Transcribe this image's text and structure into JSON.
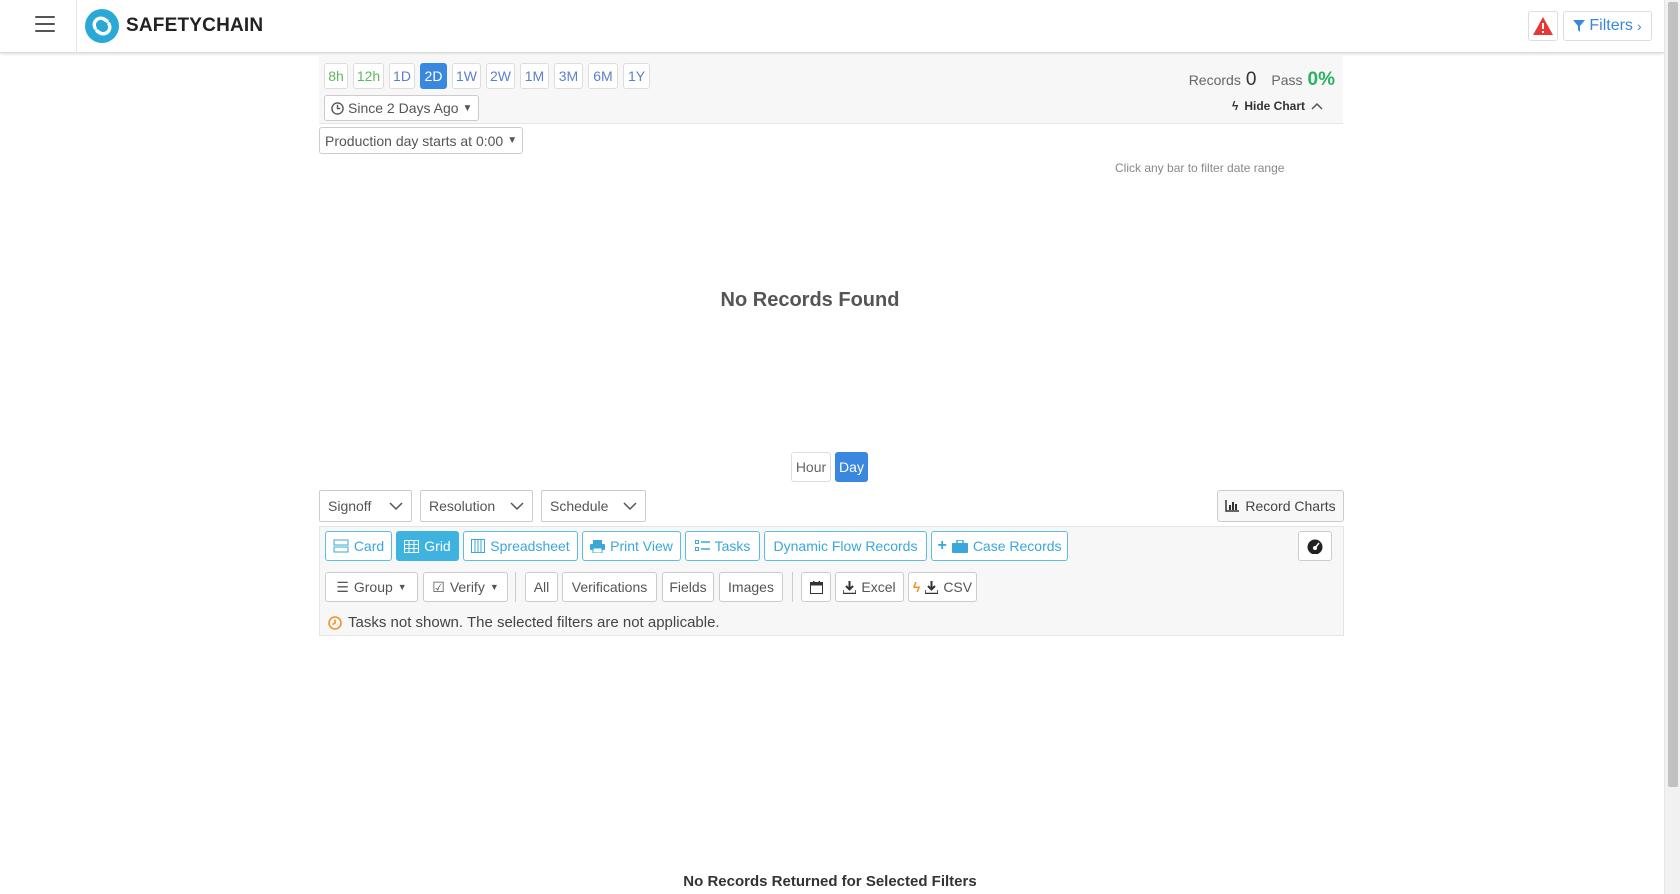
{
  "header": {
    "brand": "SAFETYCHAIN",
    "filters_label": "Filters",
    "icons": [
      "menu-icon",
      "safetychain-logo",
      "warning-icon",
      "filter-icon",
      "chevron-right-icon"
    ]
  },
  "range": {
    "buttons": [
      {
        "label": "8h",
        "state": "green"
      },
      {
        "label": "12h",
        "state": "green"
      },
      {
        "label": "1D",
        "state": "normal"
      },
      {
        "label": "2D",
        "state": "active"
      },
      {
        "label": "1W",
        "state": "normal"
      },
      {
        "label": "2W",
        "state": "normal"
      },
      {
        "label": "1M",
        "state": "normal"
      },
      {
        "label": "3M",
        "state": "normal"
      },
      {
        "label": "6M",
        "state": "normal"
      },
      {
        "label": "1Y",
        "state": "normal"
      }
    ],
    "since": "Since 2 Days Ago"
  },
  "stats": {
    "records_label": "Records",
    "records_value": "0",
    "pass_label": "Pass",
    "pass_value": "0%",
    "hide_chart": "Hide Chart"
  },
  "production_day": "Production day starts at 0:00",
  "chart": {
    "hint": "Click any bar to filter date range",
    "empty": "No Records Found",
    "hour": "Hour",
    "day": "Day"
  },
  "selects": {
    "signoff": "Signoff",
    "resolution": "Resolution",
    "schedule": "Schedule"
  },
  "record_charts": "Record Charts",
  "views": {
    "card": "Card",
    "grid": "Grid",
    "spreadsheet": "Spreadsheet",
    "print": "Print View",
    "tasks": "Tasks",
    "dynamic": "Dynamic Flow Records",
    "case": "Case Records"
  },
  "tools": {
    "group": "Group",
    "verify": "Verify",
    "all": "All",
    "verifications": "Verifications",
    "fields": "Fields",
    "images": "Images",
    "excel": "Excel",
    "csv": "CSV"
  },
  "notice": "Tasks not shown. The selected filters are not applicable.",
  "bottom_message": "No Records Returned for Selected Filters",
  "colors": {
    "accent": "#3a87e0",
    "info": "#39a8d8",
    "success": "#28b463",
    "danger": "#e53935",
    "warning": "#f0932b"
  }
}
